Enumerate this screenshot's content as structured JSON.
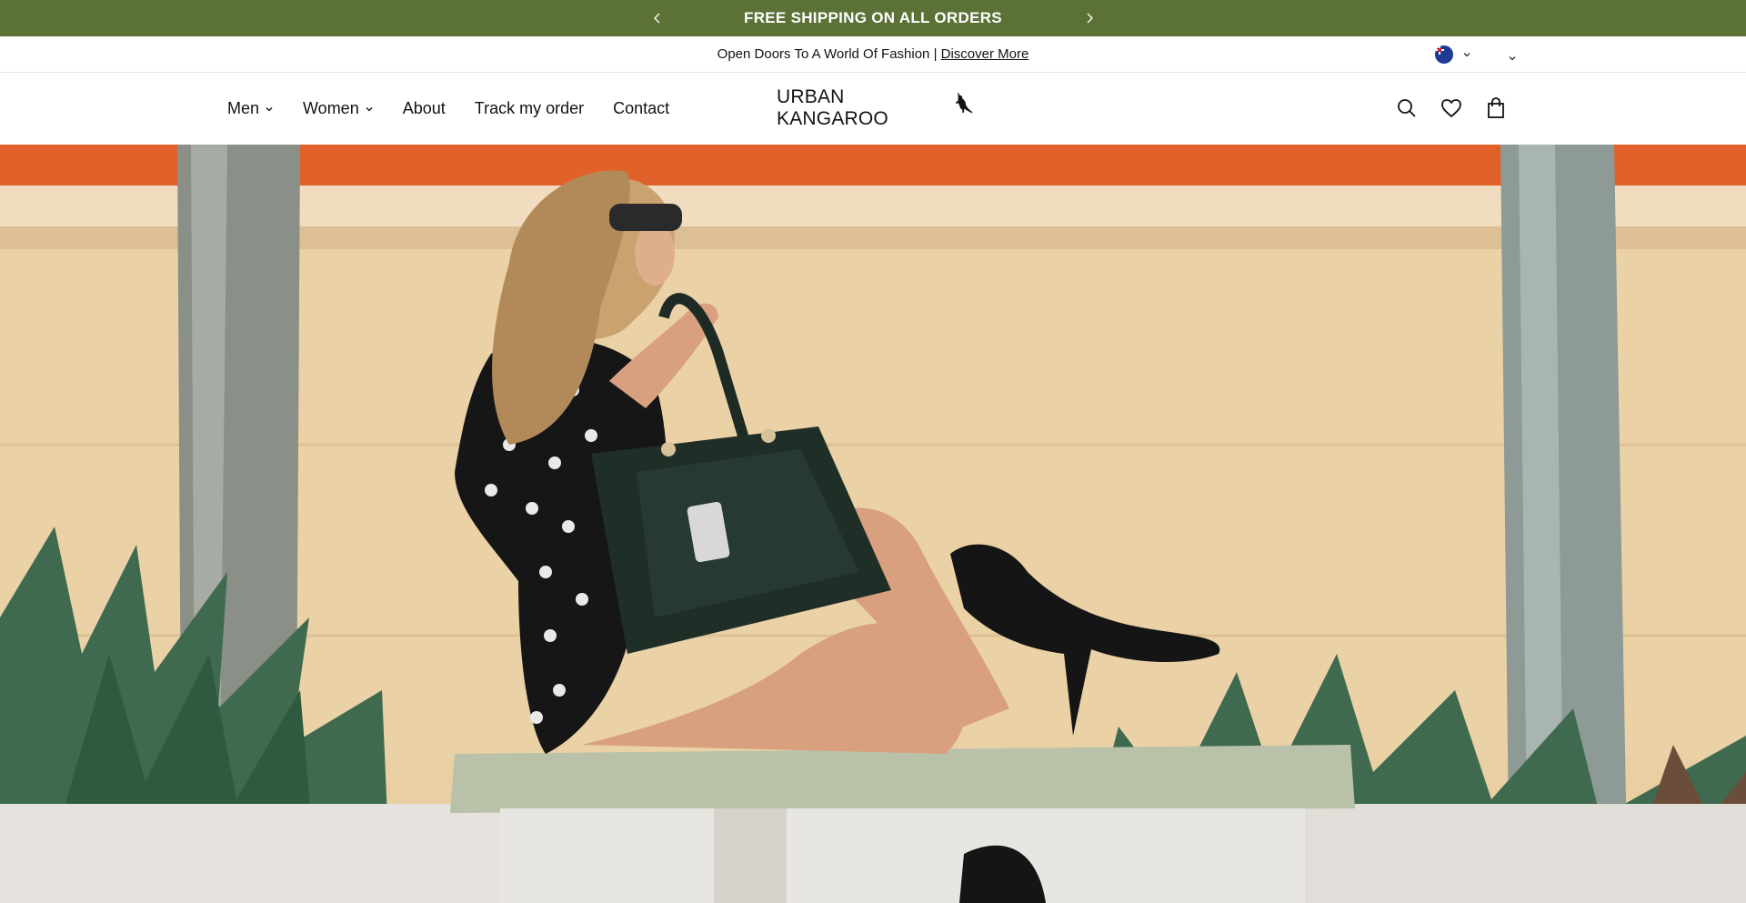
{
  "announcement": {
    "text": "FREE SHIPPING ON ALL ORDERS",
    "background": "#5b7136",
    "prev_icon": "chevron-left-icon",
    "next_icon": "chevron-right-icon"
  },
  "utility_bar": {
    "text": "Open Doors To A World Of Fashion | ",
    "link": "Discover More",
    "country_flag": "australia-flag-icon"
  },
  "nav": {
    "items": [
      {
        "label": "Men",
        "has_dropdown": true
      },
      {
        "label": "Women",
        "has_dropdown": true
      },
      {
        "label": "About",
        "has_dropdown": false
      },
      {
        "label": "Track my order",
        "has_dropdown": false
      },
      {
        "label": "Contact",
        "has_dropdown": false
      }
    ]
  },
  "logo": {
    "text": "URBAN KANGAROO",
    "icon": "kangaroo-logo-icon"
  },
  "header_icons": [
    "search-icon",
    "heart-icon",
    "shopping-bag-icon"
  ],
  "hero": {
    "image": "woman-with-black-handbag-photo"
  }
}
